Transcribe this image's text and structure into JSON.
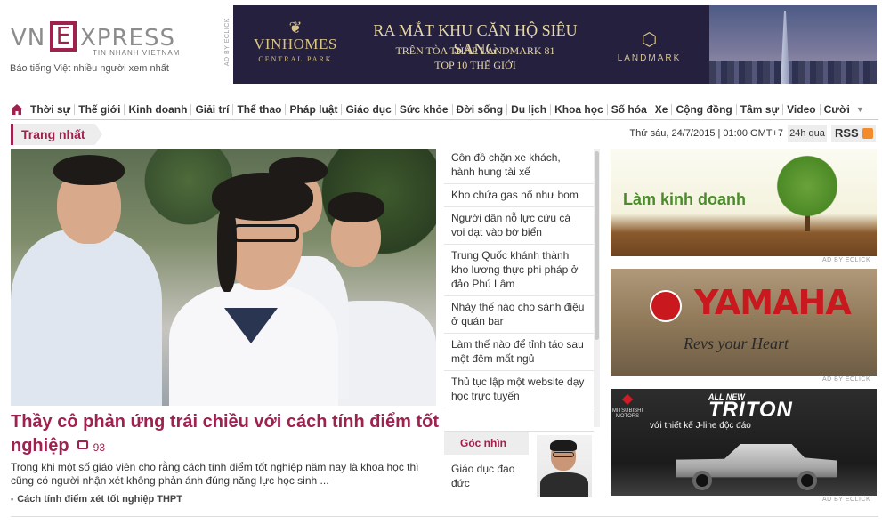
{
  "brand": {
    "logo_vn": "VN",
    "logo_e": "E",
    "logo_xpress": "XPRESS",
    "logo_sub": "TIN NHANH VIETNAM",
    "tagline": "Báo tiếng Việt nhiều người xem nhất"
  },
  "top_ad": {
    "ad_tag": "AD BY ECLICK",
    "brand_name": "VINHOMES",
    "brand_sub": "CENTRAL PARK",
    "line1": "RA MẮT KHU CĂN HỘ SIÊU SANG",
    "line2": "TRÊN TÒA THÁP LANDMARK 81",
    "line3": "TOP 10 THẾ GIỚI",
    "landmark": "LANDMARK"
  },
  "nav": {
    "items": [
      "Thời sự",
      "Thế giới",
      "Kinh doanh",
      "Giải trí",
      "Thể thao",
      "Pháp luật",
      "Giáo dục",
      "Sức khỏe",
      "Đời sống",
      "Du lịch",
      "Khoa học",
      "Số hóa",
      "Xe",
      "Cộng đồng",
      "Tâm sự",
      "Video",
      "Cười"
    ],
    "more_icon": "triangle-down-icon"
  },
  "section": {
    "title": "Trang nhất",
    "date": "Thứ sáu, 24/7/2015 | 01:00 GMT+7",
    "h24": "24h qua",
    "rss": "RSS"
  },
  "hero": {
    "title": "Thầy cô phản ứng trái chiều với cách tính điểm tốt nghiệp",
    "comments": "93",
    "lead": "Trong khi một số giáo viên cho rằng cách tính điểm tốt nghiệp năm nay là khoa học thì cũng có người nhận xét không phản ánh đúng năng lực học sinh ...",
    "related": "Cách tính điểm xét tốt nghiệp THPT"
  },
  "side_news": [
    "Côn đồ chặn xe khách, hành hung tài xế",
    "Kho chứa gas nổ như bom",
    "Người dân nỗ lực cứu cá voi dạt vào bờ biển",
    "Trung Quốc khánh thành kho lương thực phi pháp ở đảo Phú Lâm",
    "Nhảy thế nào cho sành điệu ở quán bar",
    "Làm thế nào để tỉnh táo sau một đêm mất ngủ",
    "Thủ tục lập một website dạy học trực tuyến"
  ],
  "goc_nhin": {
    "title": "Góc nhìn",
    "text": "Giáo dục đạo đức"
  },
  "right_ads": {
    "ad1_text": "Làm kinh doanh",
    "ad2_text": "YAMAHA",
    "ad2_sub": "Revs your Heart",
    "ad3_mitsu": "MITSUBISHI MOTORS",
    "ad3_new": "ALL NEW",
    "ad3_name": "TRITON",
    "ad3_tag": "với thiết kế J-line độc đáo",
    "ad_label": "AD BY ECLICK"
  },
  "colors": {
    "brand": "#9f224e",
    "text": "#333333"
  }
}
